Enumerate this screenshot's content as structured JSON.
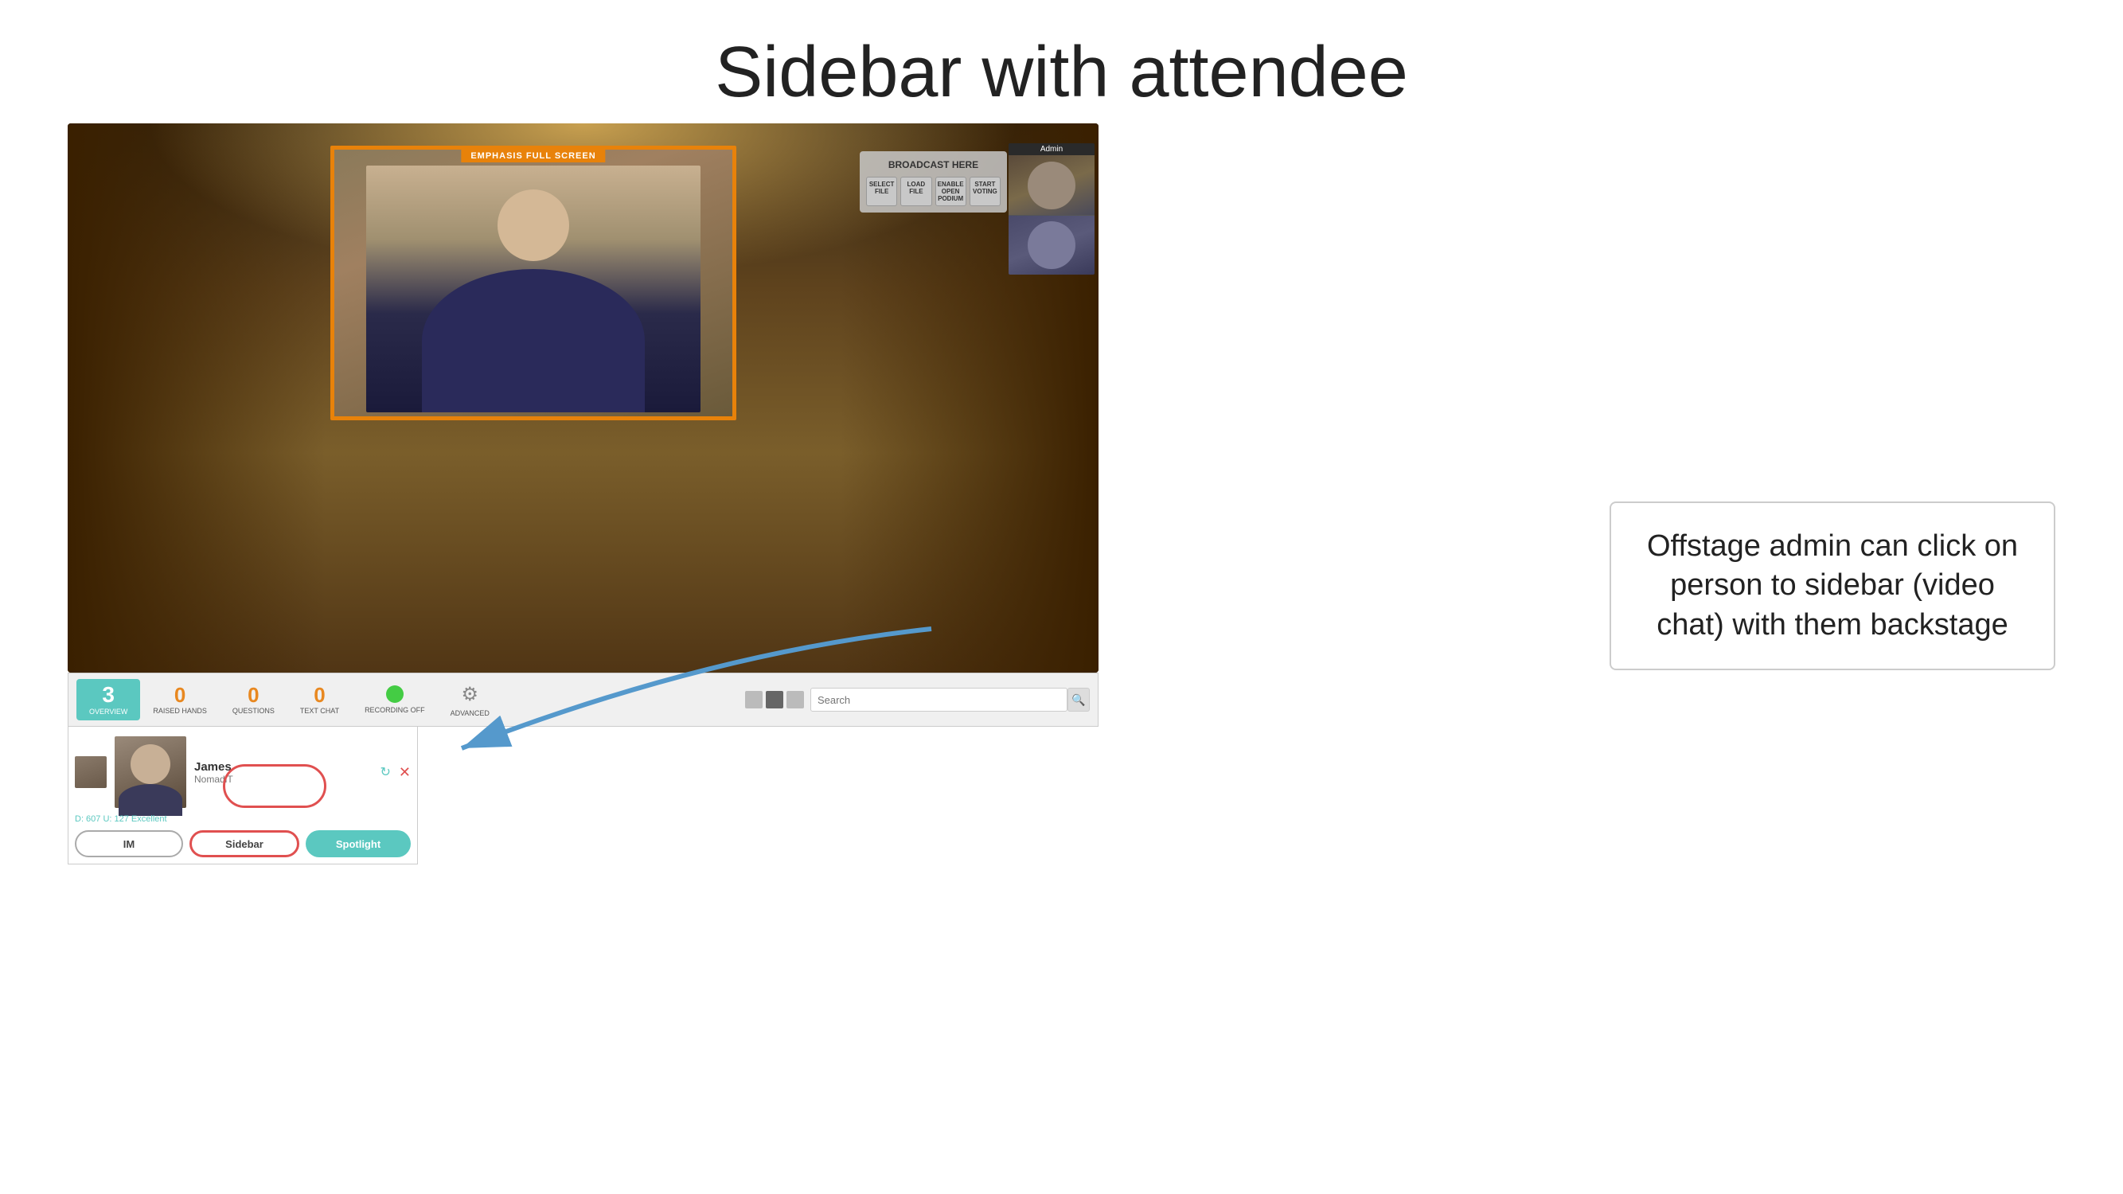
{
  "page": {
    "title": "Sidebar with attendee",
    "background": "#ffffff"
  },
  "video": {
    "emphasis_label": "EMPHASIS FULL SCREEN",
    "broadcast_title": "BROADCAST HERE",
    "broadcast_buttons": [
      "SELECT FILE",
      "LOAD FILE",
      "ENABLE OPEN PODIUM",
      "START VOTING"
    ],
    "admin_label": "Admin"
  },
  "toolbar": {
    "items": [
      {
        "number": "3",
        "label": "OVERVIEW",
        "active": true
      },
      {
        "number": "0",
        "label": "RAISED HANDS",
        "active": false
      },
      {
        "number": "0",
        "label": "QUESTIONS",
        "active": false
      },
      {
        "number": "0",
        "label": "TEXT CHAT",
        "active": false
      },
      {
        "dot": true,
        "label": "RECORDING OFF",
        "active": false
      },
      {
        "gear": true,
        "label": "ADVANCED",
        "active": false
      }
    ],
    "search_placeholder": "Search"
  },
  "attendee": {
    "name": "James",
    "company": "NomadiT",
    "stats": "D: 607  U: 127  Excellent",
    "buttons": {
      "im": "IM",
      "sidebar": "Sidebar",
      "spotlight": "Spotlight"
    }
  },
  "callout": {
    "text": "Offstage admin can click on person to sidebar (video chat) with them backstage"
  }
}
